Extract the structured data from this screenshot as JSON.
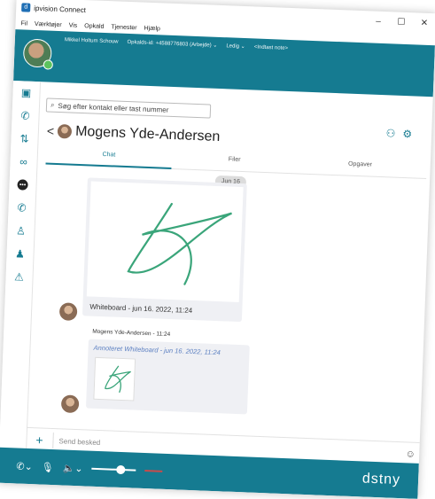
{
  "window": {
    "title": "ipvision Connect",
    "controls": [
      "–",
      "☐",
      "✕"
    ]
  },
  "menu": [
    "Fil",
    "Værktøjer",
    "Vis",
    "Opkald",
    "Tjenester",
    "Hjælp"
  ],
  "header": {
    "user": "Mikkel Holtum Schouw",
    "caller_id": "Opkalds-id: +4588776803 (Arbejde) ⌄",
    "status": "Ledig ⌄",
    "note": "<Indtast note>"
  },
  "search": {
    "placeholder": "Søg efter kontakt eller tast nummer"
  },
  "contact": {
    "name": "Mogens Yde-Andersen"
  },
  "tabs": [
    "Chat",
    "Filer",
    "Opgaver"
  ],
  "chat": {
    "date_badge": "Jun 16",
    "wb1_caption": "Whiteboard - jun 16. 2022, 11:24",
    "sender_line": "Mogens Yde-Andersen - 11:24",
    "annot_text": "Annoteret Whiteboard - jun 16. 2022, 11:24"
  },
  "composer": {
    "placeholder": "Send besked"
  },
  "footer": {
    "brand": "dstny"
  },
  "colors": {
    "brand": "#157b91",
    "presence": "#5cc35e",
    "drawing": "#3aa57a"
  }
}
